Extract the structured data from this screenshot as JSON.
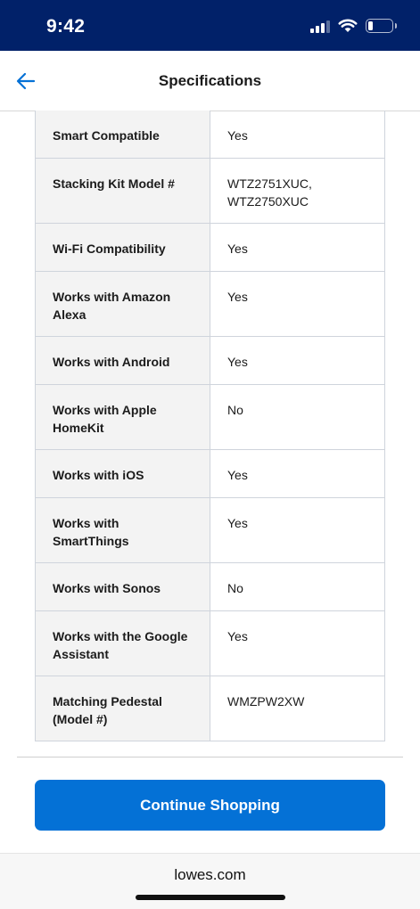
{
  "status_bar": {
    "time": "9:42"
  },
  "header": {
    "title": "Specifications"
  },
  "specs": [
    {
      "label": "Smart Compatible",
      "value": "Yes"
    },
    {
      "label": "Stacking Kit Model #",
      "value": "WTZ2751XUC, WTZ2750XUC"
    },
    {
      "label": "Wi-Fi Compatibility",
      "value": "Yes"
    },
    {
      "label": "Works with Amazon Alexa",
      "value": "Yes"
    },
    {
      "label": "Works with Android",
      "value": "Yes"
    },
    {
      "label": "Works with Apple HomeKit",
      "value": "No"
    },
    {
      "label": "Works with iOS",
      "value": "Yes"
    },
    {
      "label": "Works with SmartThings",
      "value": "Yes"
    },
    {
      "label": "Works with Sonos",
      "value": "No"
    },
    {
      "label": "Works with the Google Assistant",
      "value": "Yes"
    },
    {
      "label": "Matching Pedestal (Model #)",
      "value": "WMZPW2XW"
    }
  ],
  "actions": {
    "continue_label": "Continue Shopping"
  },
  "browser": {
    "domain": "lowes.com"
  },
  "colors": {
    "status_bar": "#012169",
    "primary_button": "#0471d6",
    "back_arrow": "#0471d6"
  },
  "icons": [
    "signal-icon",
    "wifi-icon",
    "battery-icon",
    "back-arrow-icon"
  ]
}
